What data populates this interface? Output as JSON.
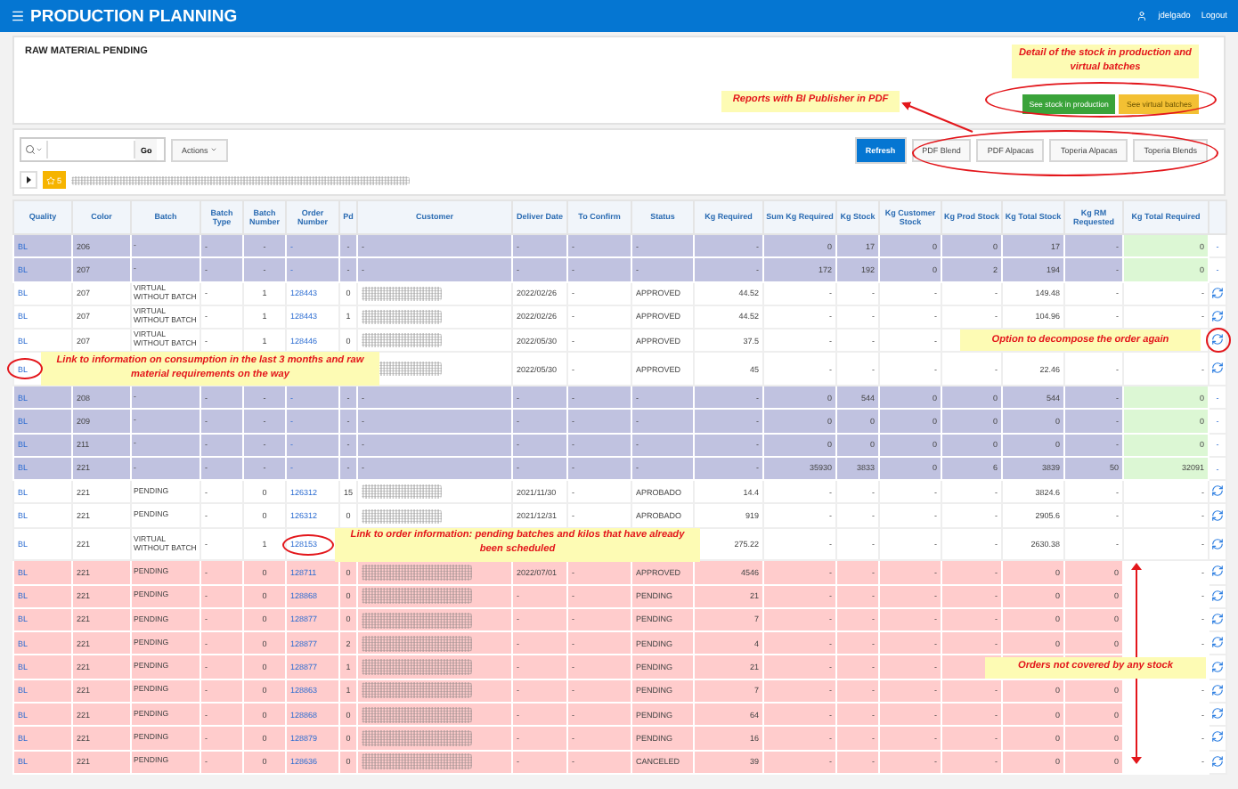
{
  "header": {
    "title": "PRODUCTION PLANNING",
    "user": "jdelgado",
    "logout": "Logout"
  },
  "region": {
    "title": "RAW MATERIAL PENDING",
    "buttons": [
      {
        "label": "See stock in production",
        "kind": "success"
      },
      {
        "label": "See virtual batches",
        "kind": "warning"
      }
    ]
  },
  "toolbar": {
    "go": "Go",
    "actions": "Actions",
    "refresh": "Refresh",
    "reports": [
      "PDF Blend",
      "PDF Alpacas",
      "Toperia Alpacas",
      "Toperia Blends"
    ]
  },
  "filter": {
    "saved_count": "5"
  },
  "table": {
    "columns": [
      "Quality",
      "Color",
      "Batch",
      "Batch Type",
      "Batch Number",
      "Order Number",
      "Pd",
      "Customer",
      "Deliver Date",
      "To Confirm",
      "Status",
      "Kg Required",
      "Sum Kg Required",
      "Kg Stock",
      "Kg Customer Stock",
      "Kg Prod Stock",
      "Kg Total Stock",
      "Kg RM Requested",
      "Kg Total Required"
    ],
    "rows": [
      {
        "kind": "summary",
        "customer_redacted": false,
        "decompose": false,
        "action_text": "-",
        "cells": [
          "BL",
          "206",
          "-",
          "-",
          "-",
          "-",
          "-",
          "-",
          "-",
          "-",
          "-",
          "-",
          "0",
          "17",
          "0",
          "0",
          "17",
          "-",
          "0"
        ]
      },
      {
        "kind": "summary",
        "customer_redacted": false,
        "decompose": false,
        "action_text": "-",
        "cells": [
          "BL",
          "207",
          "-",
          "-",
          "-",
          "-",
          "-",
          "-",
          "-",
          "-",
          "-",
          "-",
          "172",
          "192",
          "0",
          "2",
          "194",
          "-",
          "0"
        ]
      },
      {
        "kind": "order",
        "customer_redacted": true,
        "decompose": true,
        "cells": [
          "BL",
          "207",
          "VIRTUAL WITHOUT BATCH",
          "-",
          "1",
          "128443",
          "0",
          null,
          "2022/02/26",
          "-",
          "APPROVED",
          "44.52",
          "-",
          "-",
          "-",
          "-",
          "149.48",
          "-",
          "-"
        ]
      },
      {
        "kind": "order",
        "customer_redacted": true,
        "decompose": true,
        "cells": [
          "BL",
          "207",
          "VIRTUAL WITHOUT BATCH",
          "-",
          "1",
          "128443",
          "1",
          null,
          "2022/02/26",
          "-",
          "APPROVED",
          "44.52",
          "-",
          "-",
          "-",
          "-",
          "104.96",
          "-",
          "-"
        ]
      },
      {
        "kind": "order",
        "customer_redacted": true,
        "decompose": true,
        "cells": [
          "BL",
          "207",
          "VIRTUAL WITHOUT BATCH",
          "-",
          "1",
          "128446",
          "0",
          null,
          "2022/05/30",
          "-",
          "APPROVED",
          "37.5",
          "-",
          "-",
          "-",
          null,
          null,
          null,
          null
        ]
      },
      {
        "kind": "order",
        "customer_redacted": true,
        "decompose": true,
        "cells": [
          "BL",
          null,
          null,
          null,
          null,
          null,
          null,
          null,
          "2022/05/30",
          "-",
          "APPROVED",
          "45",
          "-",
          "-",
          "-",
          "-",
          "22.46",
          "-",
          "-"
        ]
      },
      {
        "kind": "summary",
        "customer_redacted": false,
        "decompose": false,
        "action_text": "-",
        "cells": [
          "BL",
          "208",
          "-",
          "-",
          "-",
          "-",
          "-",
          "-",
          "-",
          "-",
          "-",
          "-",
          "0",
          "544",
          "0",
          "0",
          "544",
          "-",
          "0"
        ]
      },
      {
        "kind": "summary",
        "customer_redacted": false,
        "decompose": false,
        "action_text": "-",
        "cells": [
          "BL",
          "209",
          "-",
          "-",
          "-",
          "-",
          "-",
          "-",
          "-",
          "-",
          "-",
          "-",
          "0",
          "0",
          "0",
          "0",
          "0",
          "-",
          "0"
        ]
      },
      {
        "kind": "summary",
        "customer_redacted": false,
        "decompose": false,
        "action_text": "-",
        "cells": [
          "BL",
          "211",
          "-",
          "-",
          "-",
          "-",
          "-",
          "-",
          "-",
          "-",
          "-",
          "-",
          "0",
          "0",
          "0",
          "0",
          "0",
          "-",
          "0"
        ]
      },
      {
        "kind": "summary",
        "customer_redacted": false,
        "decompose": false,
        "action_text": "-",
        "cells": [
          "BL",
          "221",
          "-",
          "-",
          "-",
          "-",
          "-",
          "-",
          "-",
          "-",
          "-",
          "-",
          "35930",
          "3833",
          "0",
          "6",
          "3839",
          "50",
          "32091"
        ]
      },
      {
        "kind": "order",
        "customer_redacted": true,
        "decompose": true,
        "cells": [
          "BL",
          "221",
          "PENDING",
          "-",
          "0",
          "126312",
          "15",
          null,
          "2021/11/30",
          "-",
          "APROBADO",
          "14.4",
          "-",
          "-",
          "-",
          "-",
          "3824.6",
          "-",
          "-"
        ]
      },
      {
        "kind": "order",
        "customer_redacted": true,
        "decompose": true,
        "cells": [
          "BL",
          "221",
          "PENDING",
          "-",
          "0",
          "126312",
          "0",
          null,
          "2021/12/31",
          "-",
          "APROBADO",
          "919",
          "-",
          "-",
          "-",
          "-",
          "2905.6",
          "-",
          "-"
        ]
      },
      {
        "kind": "order",
        "customer_redacted": false,
        "decompose": true,
        "cells": [
          "BL",
          "221",
          "VIRTUAL WITHOUT BATCH",
          "-",
          "1",
          "128153",
          null,
          null,
          null,
          null,
          null,
          "275.22",
          "-",
          "-",
          "-",
          "-",
          "2630.38",
          "-",
          "-"
        ]
      },
      {
        "kind": "uncovered",
        "customer_redacted": true,
        "decompose": true,
        "cells": [
          "BL",
          "221",
          "PENDING",
          "-",
          "0",
          "128711",
          "0",
          null,
          "2022/07/01",
          "-",
          "APPROVED",
          "4546",
          "-",
          "-",
          "-",
          "-",
          "0",
          "0",
          "-"
        ]
      },
      {
        "kind": "uncovered",
        "customer_redacted": true,
        "decompose": true,
        "cells": [
          "BL",
          "221",
          "PENDING",
          "-",
          "0",
          "128868",
          "0",
          null,
          "-",
          "-",
          "PENDING",
          "21",
          "-",
          "-",
          "-",
          "-",
          "0",
          "0",
          "-"
        ]
      },
      {
        "kind": "uncovered",
        "customer_redacted": true,
        "decompose": true,
        "cells": [
          "BL",
          "221",
          "PENDING",
          "-",
          "0",
          "128877",
          "0",
          null,
          "-",
          "-",
          "PENDING",
          "7",
          "-",
          "-",
          "-",
          "-",
          "0",
          "0",
          "-"
        ]
      },
      {
        "kind": "uncovered",
        "customer_redacted": true,
        "decompose": true,
        "cells": [
          "BL",
          "221",
          "PENDING",
          "-",
          "0",
          "128877",
          "2",
          null,
          "-",
          "-",
          "PENDING",
          "4",
          "-",
          "-",
          "-",
          "-",
          "0",
          "0",
          "-"
        ]
      },
      {
        "kind": "uncovered",
        "customer_redacted": true,
        "decompose": true,
        "cells": [
          "BL",
          "221",
          "PENDING",
          "-",
          "0",
          "128877",
          "1",
          null,
          "-",
          "-",
          "PENDING",
          "21",
          "-",
          "-",
          "-",
          null,
          null,
          null,
          null
        ]
      },
      {
        "kind": "uncovered",
        "customer_redacted": true,
        "decompose": true,
        "cells": [
          "BL",
          "221",
          "PENDING",
          "-",
          "0",
          "128863",
          "1",
          null,
          "-",
          "-",
          "PENDING",
          "7",
          "-",
          "-",
          "-",
          "-",
          "0",
          "0",
          "-"
        ]
      },
      {
        "kind": "uncovered",
        "customer_redacted": true,
        "decompose": true,
        "cells": [
          "BL",
          "221",
          "PENDING",
          "-",
          "0",
          "128868",
          "0",
          null,
          "-",
          "-",
          "PENDING",
          "64",
          "-",
          "-",
          "-",
          "-",
          "0",
          "0",
          "-"
        ]
      },
      {
        "kind": "uncovered",
        "customer_redacted": true,
        "decompose": true,
        "cells": [
          "BL",
          "221",
          "PENDING",
          "-",
          "0",
          "128879",
          "0",
          null,
          "-",
          "-",
          "PENDING",
          "16",
          "-",
          "-",
          "-",
          "-",
          "0",
          "0",
          "-"
        ]
      },
      {
        "kind": "uncovered",
        "customer_redacted": true,
        "decompose": true,
        "cells": [
          "BL",
          "221",
          "PENDING",
          "-",
          "0",
          "128636",
          "0",
          null,
          "-",
          "-",
          "CANCELED",
          "39",
          "-",
          "-",
          "-",
          "-",
          "0",
          "0",
          "-"
        ]
      }
    ]
  },
  "annotations": [
    {
      "text": "Detail of the stock in production and virtual batches"
    },
    {
      "text": "Reports with BI Publisher in PDF"
    },
    {
      "text": "Link to information on consumption in the last 3 months and raw material requirements on the way"
    },
    {
      "text": "Option to decompose the order again"
    },
    {
      "text": "Link to order information: pending batches and kilos that have already been scheduled"
    },
    {
      "text": "Orders not covered by any stock"
    }
  ]
}
